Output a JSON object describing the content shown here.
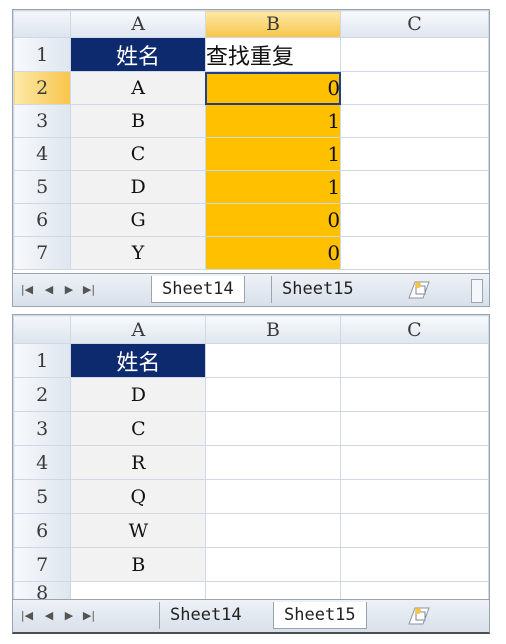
{
  "pane1": {
    "columns": [
      "A",
      "B",
      "C"
    ],
    "rows": [
      {
        "num": "1",
        "a": "姓名",
        "b": "查找重复"
      },
      {
        "num": "2",
        "a": "A",
        "b": "0"
      },
      {
        "num": "3",
        "a": "B",
        "b": "1"
      },
      {
        "num": "4",
        "a": "C",
        "b": "1"
      },
      {
        "num": "5",
        "a": "D",
        "b": "1"
      },
      {
        "num": "6",
        "a": "G",
        "b": "0"
      },
      {
        "num": "7",
        "a": "Y",
        "b": "0"
      }
    ],
    "tabs": [
      "Sheet14",
      "Sheet15"
    ],
    "active_tab": "Sheet14"
  },
  "pane2": {
    "columns": [
      "A",
      "B",
      "C"
    ],
    "rows": [
      {
        "num": "1",
        "a": "姓名"
      },
      {
        "num": "2",
        "a": "D"
      },
      {
        "num": "3",
        "a": "C"
      },
      {
        "num": "4",
        "a": "R"
      },
      {
        "num": "5",
        "a": "Q"
      },
      {
        "num": "6",
        "a": "W"
      },
      {
        "num": "7",
        "a": "B"
      },
      {
        "num": "8",
        "a": ""
      }
    ],
    "tabs": [
      "Sheet14",
      "Sheet15"
    ],
    "active_tab": "Sheet15"
  },
  "nav_icons": [
    "first-sheet-icon",
    "prev-sheet-icon",
    "next-sheet-icon",
    "last-sheet-icon"
  ],
  "colors": {
    "header_fill": "#0e2a6e",
    "highlight_fill": "#ffc000",
    "name_col_fill": "#f2f2f2"
  }
}
